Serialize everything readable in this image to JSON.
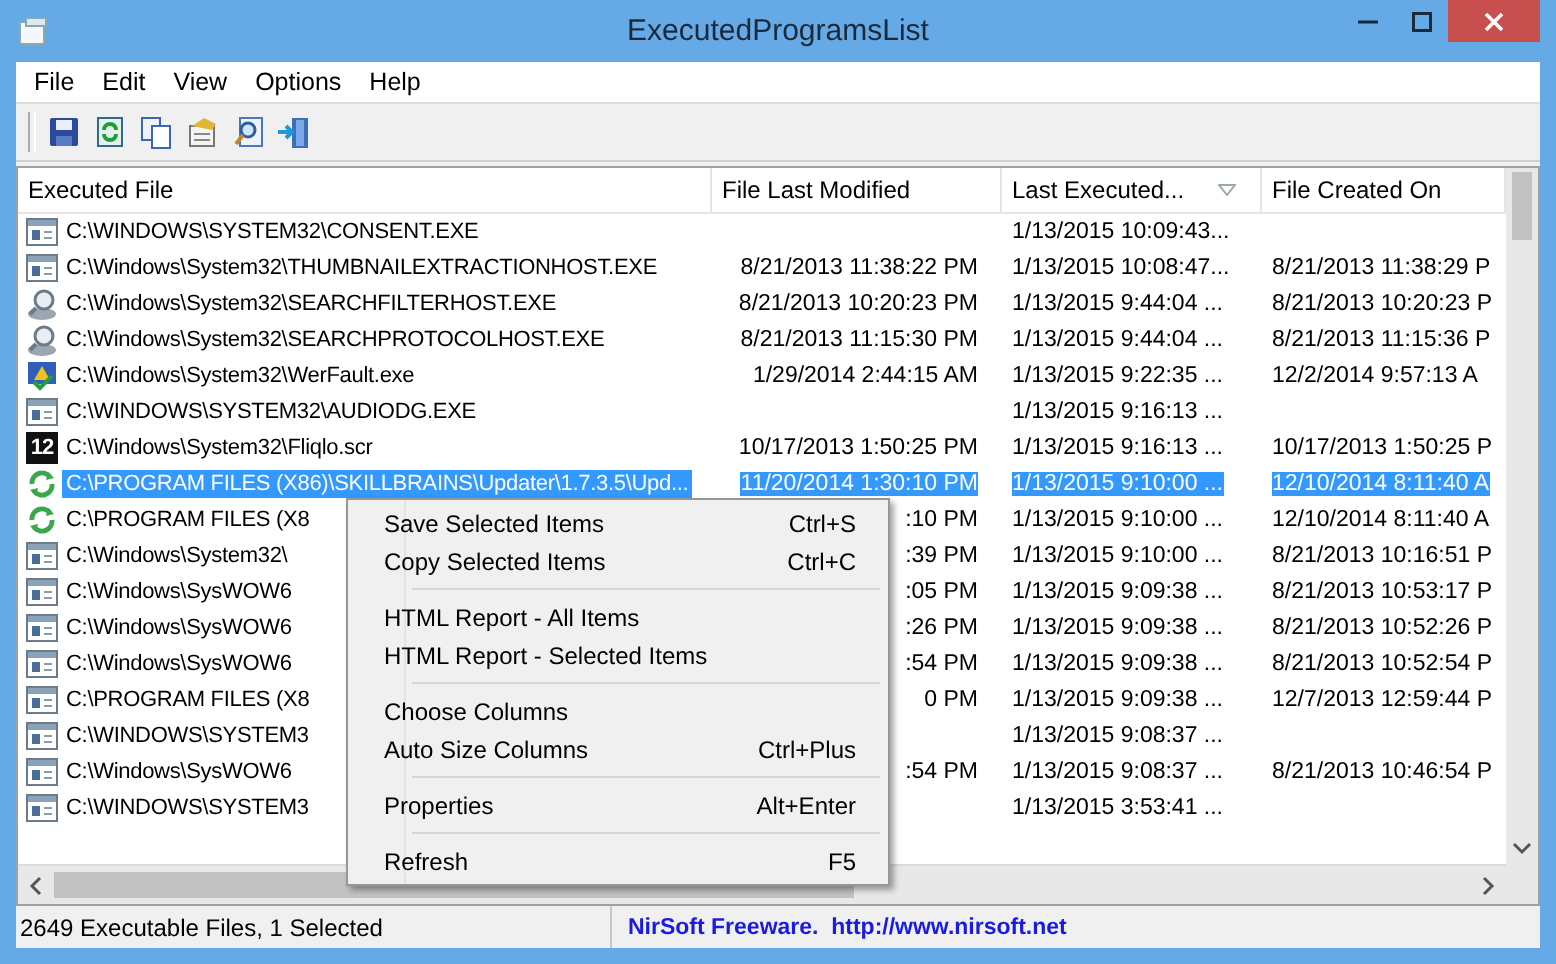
{
  "window": {
    "title": "ExecutedProgramsList"
  },
  "menu_bar": [
    "File",
    "Edit",
    "View",
    "Options",
    "Help"
  ],
  "toolbar": [
    {
      "kind": "save"
    },
    {
      "kind": "refresh"
    },
    {
      "kind": "copy"
    },
    {
      "kind": "properties"
    },
    {
      "kind": "find"
    },
    {
      "kind": "exit"
    }
  ],
  "table": {
    "columns": [
      {
        "label": "Executed File",
        "sorted": false
      },
      {
        "label": "File Last Modified",
        "sorted": false
      },
      {
        "label": "Last Executed...",
        "sorted": true
      },
      {
        "label": "File Created On",
        "sorted": false
      }
    ],
    "rows": [
      {
        "kind": "window",
        "file": "C:\\WINDOWS\\SYSTEM32\\CONSENT.EXE",
        "executed": "1/13/2015 10:09:43...",
        "selected": false
      },
      {
        "kind": "window",
        "file": "C:\\Windows\\System32\\THUMBNAILEXTRACTIONHOST.EXE",
        "modified": "8/21/2013 11:38:22 PM",
        "executed": "1/13/2015 10:08:47...",
        "created": "8/21/2013 11:38:29 P",
        "selected": false
      },
      {
        "kind": "search",
        "file": "C:\\Windows\\System32\\SEARCHFILTERHOST.EXE",
        "modified": "8/21/2013 10:20:23 PM",
        "executed": "1/13/2015 9:44:04 ...",
        "created": "8/21/2013 10:20:23 P",
        "selected": false
      },
      {
        "kind": "search",
        "file": "C:\\Windows\\System32\\SEARCHPROTOCOLHOST.EXE",
        "modified": "8/21/2013 11:15:30 PM",
        "executed": "1/13/2015 9:44:04 ...",
        "created": "8/21/2013 11:15:36 P",
        "selected": false
      },
      {
        "kind": "monitor",
        "file": "C:\\Windows\\System32\\WerFault.exe",
        "modified": "1/29/2014 2:44:15 AM",
        "executed": "1/13/2015 9:22:35 ...",
        "created": "12/2/2014 9:57:13 A",
        "selected": false
      },
      {
        "kind": "window",
        "file": "C:\\WINDOWS\\SYSTEM32\\AUDIODG.EXE",
        "executed": "1/13/2015 9:16:13 ...",
        "selected": false
      },
      {
        "kind": "badge",
        "icon_text": "12",
        "file": "C:\\Windows\\System32\\Fliqlo.scr",
        "modified": "10/17/2013 1:50:25 PM",
        "executed": "1/13/2015 9:16:13 ...",
        "created": "10/17/2013 1:50:25 P",
        "selected": false
      },
      {
        "kind": "cycle",
        "file": "C:\\PROGRAM FILES (X86)\\SKILLBRAINS\\Updater\\1.7.3.5\\Upd...",
        "modified": "11/20/2014 1:30:10 PM",
        "executed": "1/13/2015 9:10:00 ...",
        "created": "12/10/2014 8:11:40 A",
        "selected": true
      },
      {
        "kind": "cycle",
        "file": "C:\\PROGRAM FILES (X8",
        "modified": ":10 PM",
        "executed": "1/13/2015 9:10:00 ...",
        "created": "12/10/2014 8:11:40 A",
        "selected": false
      },
      {
        "kind": "window",
        "file": "C:\\Windows\\System32\\",
        "modified": ":39 PM",
        "executed": "1/13/2015 9:10:00 ...",
        "created": "8/21/2013 10:16:51 P",
        "selected": false
      },
      {
        "kind": "window",
        "file": "C:\\Windows\\SysWOW6",
        "modified": ":05 PM",
        "executed": "1/13/2015 9:09:38 ...",
        "created": "8/21/2013 10:53:17 P",
        "selected": false
      },
      {
        "kind": "window",
        "file": "C:\\Windows\\SysWOW6",
        "modified": ":26 PM",
        "executed": "1/13/2015 9:09:38 ...",
        "created": "8/21/2013 10:52:26 P",
        "selected": false
      },
      {
        "kind": "window",
        "file": "C:\\Windows\\SysWOW6",
        "modified": ":54 PM",
        "executed": "1/13/2015 9:09:38 ...",
        "created": "8/21/2013 10:52:54 P",
        "selected": false
      },
      {
        "kind": "window",
        "file": "C:\\PROGRAM FILES (X8",
        "modified": "0 PM",
        "executed": "1/13/2015 9:09:38 ...",
        "created": "12/7/2013 12:59:44 P",
        "selected": false
      },
      {
        "kind": "window",
        "file": "C:\\WINDOWS\\SYSTEM3",
        "executed": "1/13/2015 9:08:37 ...",
        "selected": false
      },
      {
        "kind": "window",
        "file": "C:\\Windows\\SysWOW6",
        "modified": ":54 PM",
        "executed": "1/13/2015 9:08:37 ...",
        "created": "8/21/2013 10:46:54 P",
        "selected": false
      },
      {
        "kind": "window",
        "file": "C:\\WINDOWS\\SYSTEM3",
        "executed": "1/13/2015 3:53:41 ...",
        "selected": false
      }
    ]
  },
  "context_menu": {
    "groups": [
      [
        {
          "label": "Save Selected Items",
          "shortcut": "Ctrl+S"
        },
        {
          "label": "Copy Selected Items",
          "shortcut": "Ctrl+C"
        }
      ],
      [
        {
          "label": "HTML Report - All Items"
        },
        {
          "label": "HTML Report - Selected Items"
        }
      ],
      [
        {
          "label": "Choose Columns"
        },
        {
          "label": "Auto Size Columns",
          "shortcut": "Ctrl+Plus"
        }
      ],
      [
        {
          "label": "Properties",
          "shortcut": "Alt+Enter"
        }
      ],
      [
        {
          "label": "Refresh",
          "shortcut": "F5"
        }
      ]
    ]
  },
  "status_bar": {
    "count": "2649 Executable Files, 1 Selected",
    "link": "NirSoft Freeware.  http://www.nirsoft.net"
  }
}
